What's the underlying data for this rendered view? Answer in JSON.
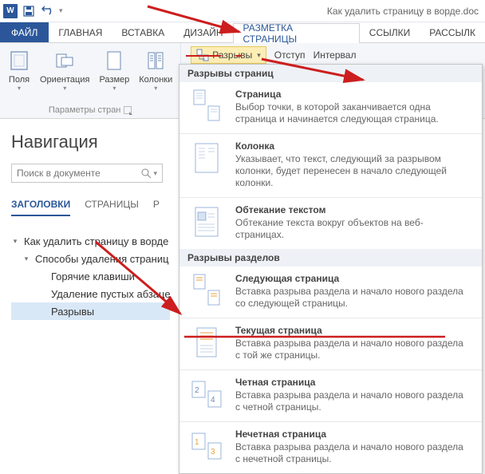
{
  "titlebar": {
    "doc_title": "Как удалить страницу в ворде.doc"
  },
  "tabs": {
    "file": "ФАЙЛ",
    "home": "ГЛАВНАЯ",
    "insert": "ВСТАВКА",
    "design": "ДИЗАЙН",
    "page_layout": "РАЗМЕТКА СТРАНИЦЫ",
    "references": "ССЫЛКИ",
    "mailings": "РАССЫЛК"
  },
  "ribbon": {
    "margins": "Поля",
    "orientation": "Ориентация",
    "size": "Размер",
    "columns": "Колонки",
    "page_setup_caption": "Параметры стран",
    "breaks": "Разрывы",
    "indent_label": "Отступ",
    "spacing_label": "Интервал"
  },
  "nav": {
    "title": "Навигация",
    "search_placeholder": "Поиск в документе",
    "tabs": {
      "headings": "ЗАГОЛОВКИ",
      "pages": "СТРАНИЦЫ",
      "results": "Р"
    },
    "tree": {
      "root0": "Как удалить страницу в ворде",
      "c1": "Способы удаления страниц",
      "c2a": "Горячие клавиши",
      "c2b": "Удаление пустых абзацев в",
      "c2c": "Разрывы"
    }
  },
  "gallery": {
    "h1": "Разрывы страниц",
    "page": {
      "t": "Страница",
      "d": "Выбор точки, в которой заканчивается одна страница и начинается следующая страница."
    },
    "column": {
      "t": "Колонка",
      "d": "Указывает, что текст, следующий за разрывом колонки, будет перенесен в начало следующей колонки."
    },
    "textwrap": {
      "t": "Обтекание текстом",
      "d": "Обтекание текста вокруг объектов на веб-страницах."
    },
    "h2": "Разрывы разделов",
    "nextpage": {
      "t": "Следующая страница",
      "d": "Вставка разрыва раздела и начало нового раздела со следующей страницы."
    },
    "continuous": {
      "t": "Текущая страница",
      "d": "Вставка разрыва раздела и начало нового раздела с той же страницы."
    },
    "evenpage": {
      "t": "Четная страница",
      "d": "Вставка разрыва раздела и начало нового раздела с четной страницы."
    },
    "oddpage": {
      "t": "Нечетная страница",
      "d": "Вставка разрыва раздела и начало нового раздела с нечетной страницы."
    }
  }
}
